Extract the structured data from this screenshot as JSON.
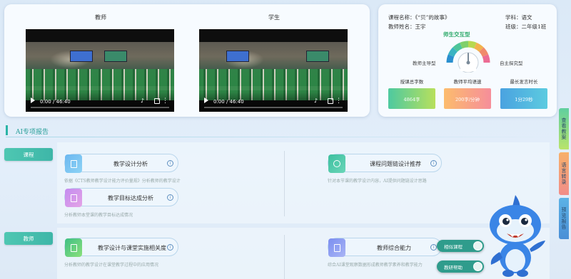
{
  "video": {
    "teacher_label": "教师",
    "student_label": "学生",
    "teacher_time": "0:00 / 46:40",
    "student_time": "0:00 / 46:40"
  },
  "course": {
    "name_label": "课程名称：",
    "name_value": "《“贝”的故事》",
    "subject_label": "学科：",
    "subject_value": "语文",
    "teacher_label": "教师姓名：",
    "teacher_value": "王宇",
    "grade_label": "班级：",
    "grade_value": "二年级1班",
    "gauge_title": "师生交互型",
    "gauge_left": "教师主导型",
    "gauge_right": "自主探究型",
    "gauge_level": 0.5,
    "stats": [
      {
        "label": "授课总字数",
        "value": "4864字",
        "color": "#52c99a"
      },
      {
        "label": "教师平均语速",
        "value": "200字/分钟",
        "color": "#f9a87a"
      },
      {
        "label": "最长发言时长",
        "value": "1分29秒",
        "color": "#4ba6dc"
      }
    ]
  },
  "report": {
    "title": "AI专项报告"
  },
  "sections": [
    {
      "tag": "课程",
      "items": [
        {
          "title": "教学设计分析",
          "desc": "依据《CTS教师教学设计能力评价量规》分析教师的教学设计"
        },
        {
          "title": "课程问题链设计推荐",
          "desc": "针对本节课的教学设计内容，AI提供问题链设计思路"
        },
        {
          "title": "教学目标达成分析",
          "desc": "分析教师本堂课的教学目标达成情况"
        }
      ]
    },
    {
      "tag": "教师",
      "items": [
        {
          "title": "教学设计与课堂实施相关度",
          "desc": "分析教师的教学设计在课堂教学过程中的应用情况"
        },
        {
          "title": "教师综合能力",
          "desc": "综合AI课堂观察数据形成教师教学素养和教学能力"
        }
      ]
    }
  ],
  "side_tabs": [
    "查看教案",
    "语言转录",
    "预览报告"
  ],
  "float_buttons": [
    "相似课程",
    "教研帮助"
  ],
  "colors": {
    "accent": "#2bb4a6",
    "tab_green": "#49c6a1",
    "tab_orange": "#f39a5e",
    "tab_blue": "#4a9dd8"
  }
}
